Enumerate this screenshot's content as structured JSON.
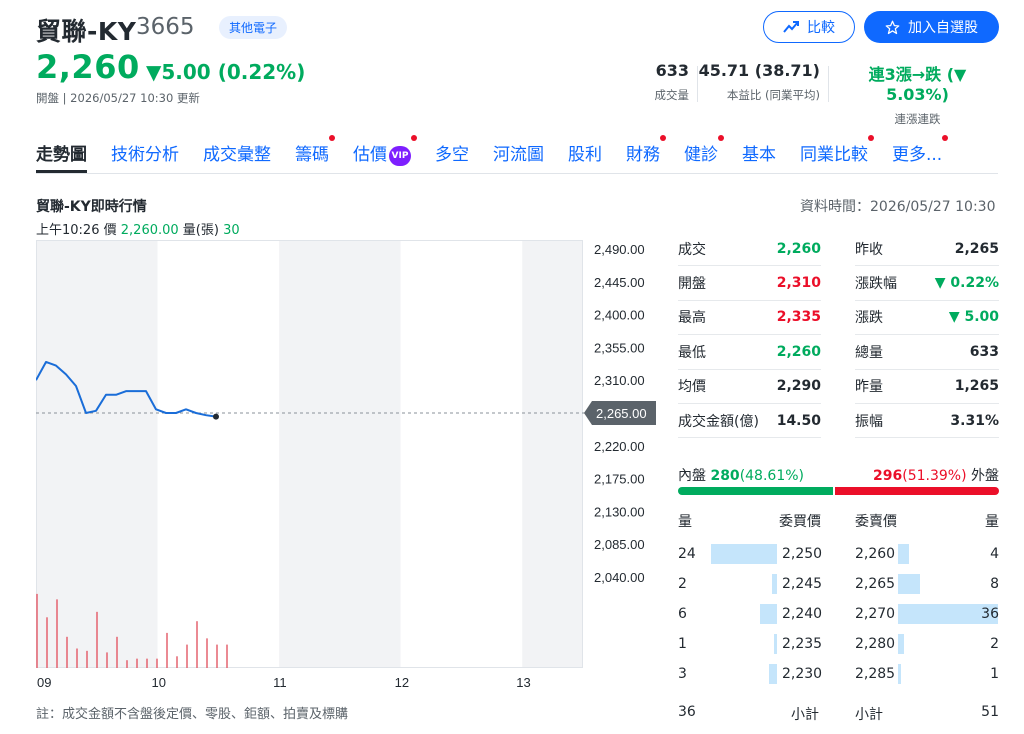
{
  "header": {
    "name": "貿聯-KY",
    "code": "3665",
    "sector": "其他電子",
    "price": "2,260",
    "change": "▼5.00 (0.22%)",
    "status": "開盤 | 2026/05/27 10:30 更新",
    "compare_label": "比較",
    "watchlist_label": "加入自選股",
    "stats": [
      {
        "value": "633",
        "label": "成交量"
      },
      {
        "value": "45.71 (38.71)",
        "label": "本益比 (同業平均)"
      },
      {
        "value": "連3漲→跌 (▼ 5.03%)",
        "label": "連漲連跌"
      }
    ]
  },
  "tabs": [
    {
      "label": "走勢圖",
      "active": true,
      "dot": false,
      "vip": false
    },
    {
      "label": "技術分析",
      "dot": false
    },
    {
      "label": "成交彙整",
      "dot": false
    },
    {
      "label": "籌碼",
      "dot": true
    },
    {
      "label": "估價",
      "dot": true,
      "vip": true
    },
    {
      "label": "多空",
      "dot": false
    },
    {
      "label": "河流圖",
      "dot": false
    },
    {
      "label": "股利",
      "dot": false
    },
    {
      "label": "財務",
      "dot": true
    },
    {
      "label": "健診",
      "dot": true
    },
    {
      "label": "基本",
      "dot": false
    },
    {
      "label": "同業比較",
      "dot": true
    },
    {
      "label": "更多...",
      "dot": true
    }
  ],
  "vip_label": "VIP",
  "chart": {
    "title": "貿聯-KY即時行情",
    "data_time": "資料時間：2026/05/27 10:30",
    "tick_time": "上午10:26",
    "tick_price_label": "價",
    "tick_price": "2,260.00",
    "tick_vol_label": "量(張)",
    "tick_vol": "30",
    "current_label": "2,265.00",
    "y_ticks": [
      "2,490.00",
      "2,445.00",
      "2,400.00",
      "2,355.00",
      "2,310.00",
      "2,220.00",
      "2,175.00",
      "2,130.00",
      "2,085.00",
      "2,040.00"
    ],
    "x_ticks": [
      "09",
      "10",
      "11",
      "12",
      "13"
    ]
  },
  "chart_data": {
    "type": "line",
    "ylim": [
      2040,
      2490
    ],
    "reference": 2265,
    "x_minutes": [
      0,
      10,
      20,
      30,
      40,
      50,
      60,
      70,
      80,
      90,
      100,
      110,
      120,
      130,
      140,
      150,
      160,
      170,
      180,
      190,
      200,
      210,
      220,
      230,
      240,
      250,
      260,
      270,
      280,
      290
    ],
    "price": [
      2310,
      2335,
      2330,
      2318,
      2302,
      2265,
      2268,
      2290,
      2290,
      2295,
      2295,
      2295,
      2270,
      2265,
      2265,
      2270,
      2265,
      2262,
      2260
    ],
    "volume": [
      95,
      65,
      88,
      40,
      25,
      22,
      72,
      20,
      40,
      10,
      12,
      12,
      12,
      45,
      15,
      30,
      60,
      38,
      30,
      30
    ],
    "color_line": "#1a6dd8",
    "color_volume": "#e4626f"
  },
  "quote": {
    "left": [
      {
        "label": "成交",
        "value": "2,260",
        "color": "green"
      },
      {
        "label": "開盤",
        "value": "2,310",
        "color": "red"
      },
      {
        "label": "最高",
        "value": "2,335",
        "color": "red"
      },
      {
        "label": "最低",
        "value": "2,260",
        "color": "green"
      },
      {
        "label": "均價",
        "value": "2,290",
        "color": "dark"
      },
      {
        "label": "成交金額(億)",
        "value": "14.50",
        "color": "dark"
      }
    ],
    "right": [
      {
        "label": "昨收",
        "value": "2,265",
        "color": "dark"
      },
      {
        "label": "漲跌幅",
        "value": "▼ 0.22%",
        "color": "green"
      },
      {
        "label": "漲跌",
        "value": "▼ 5.00",
        "color": "green"
      },
      {
        "label": "總量",
        "value": "633",
        "color": "dark"
      },
      {
        "label": "昨量",
        "value": "1,265",
        "color": "dark"
      },
      {
        "label": "振幅",
        "value": "3.31%",
        "color": "dark"
      }
    ]
  },
  "orderbook": {
    "inner_label": "內盤",
    "inner_value": "280",
    "inner_pct": "(48.61%)",
    "outer_value": "296",
    "outer_pct": "(51.39%)",
    "outer_label": "外盤",
    "inner_share": 0.4861,
    "head": {
      "qty": "量",
      "bid": "委買價",
      "ask": "委賣價",
      "qty2": "量"
    },
    "bids": [
      {
        "qty": "24",
        "price": "2,250",
        "share": 1.0
      },
      {
        "qty": "2",
        "price": "2,245",
        "share": 0.08
      },
      {
        "qty": "6",
        "price": "2,240",
        "share": 0.25
      },
      {
        "qty": "1",
        "price": "2,235",
        "share": 0.04
      },
      {
        "qty": "3",
        "price": "2,230",
        "share": 0.12
      }
    ],
    "asks": [
      {
        "price": "2,260",
        "qty": "4",
        "share": 0.11
      },
      {
        "price": "2,265",
        "qty": "8",
        "share": 0.22
      },
      {
        "price": "2,270",
        "qty": "36",
        "share": 1.0
      },
      {
        "price": "2,280",
        "qty": "2",
        "share": 0.06
      },
      {
        "price": "2,285",
        "qty": "1",
        "share": 0.03
      }
    ],
    "bid_total": "36",
    "subtotal_label": "小計",
    "ask_total": "51"
  },
  "footnote": "註：成交金額不含盤後定價、零股、鉅額、拍賣及標購"
}
